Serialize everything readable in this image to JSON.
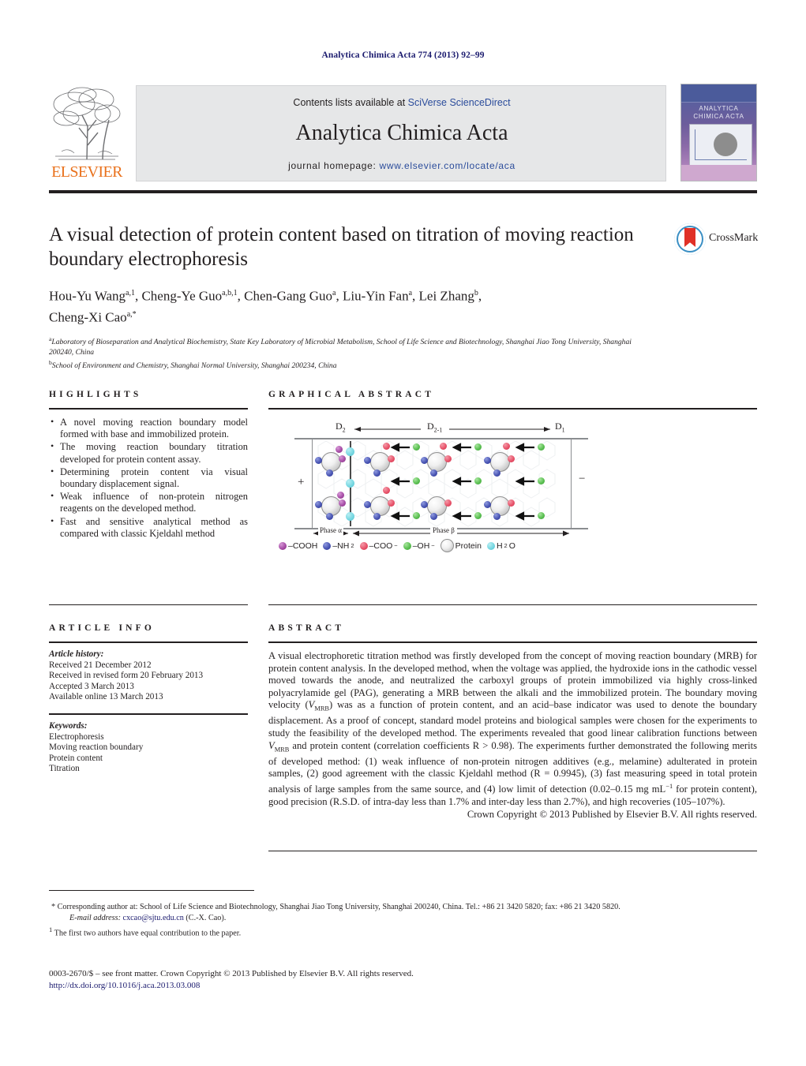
{
  "running_head": "Analytica Chimica Acta 774 (2013) 92–99",
  "masthead": {
    "publisher_name": "ELSEVIER",
    "contents_prefix": "Contents lists available at ",
    "contents_link": "SciVerse ScienceDirect",
    "journal_name": "Analytica Chimica Acta",
    "homepage_prefix": "journal homepage: ",
    "homepage_url": "www.elsevier.com/locate/aca",
    "cover_title_line1": "ANALYTICA",
    "cover_title_line2": "CHIMICA ACTA"
  },
  "article": {
    "title": "A visual detection of protein content based on titration of moving reaction boundary electrophoresis",
    "authors_line1_p1": "Hou-Yu Wang",
    "authors_line1_s1": "a,1",
    "authors_line1_p2": ", Cheng-Ye Guo",
    "authors_line1_s2": "a,b,1",
    "authors_line1_p3": ", Chen-Gang Guo",
    "authors_line1_s3": "a",
    "authors_line1_p4": ", Liu-Yin Fan",
    "authors_line1_s4": "a",
    "authors_line1_p5": ", Lei Zhang",
    "authors_line1_s5": "b",
    "authors_line1_p6": ",",
    "authors_line2_p1": "Cheng-Xi Cao",
    "authors_line2_s1": "a,*",
    "affiliation_a_marker": "a",
    "affiliation_a": "Laboratory of Bioseparation and Analytical Biochemistry, State Key Laboratory of Microbial Metabolism, School of Life Science and Biotechnology, Shanghai Jiao Tong University, Shanghai 200240, China",
    "affiliation_b_marker": "b",
    "affiliation_b": "School of Environment and Chemistry, Shanghai Normal University, Shanghai 200234, China",
    "crossmark_label": "CrossMark"
  },
  "highlights": {
    "heading": "HIGHLIGHTS",
    "items": [
      "A novel moving reaction boundary model formed with base and immobilized protein.",
      "The moving reaction boundary titration developed for protein content assay.",
      "Determining protein content via visual boundary displacement signal.",
      "Weak influence of non-protein nitrogen reagents on the developed method.",
      "Fast and sensitive analytical method as compared with classic Kjeldahl method"
    ]
  },
  "graphical_abstract": {
    "heading": "GRAPHICAL ABSTRACT",
    "label_d2": "D",
    "label_d2_sub": "2",
    "label_d21": "D",
    "label_d21_sub": "2-1",
    "label_d1": "D",
    "label_d1_sub": "1",
    "anode_sign": "+",
    "cathode_sign": "−",
    "phase_alpha": "Phase α",
    "phase_beta": "Phase β",
    "legend": [
      {
        "name": "cooh-legend",
        "label": "–COOH",
        "color": "#a84fa8"
      },
      {
        "name": "nh2-legend",
        "label": "–NH",
        "sub": "2",
        "color": "#4a56b4"
      },
      {
        "name": "coo-legend",
        "label": "–COO",
        "sup": "−",
        "color": "#e8556c"
      },
      {
        "name": "oh-legend",
        "label": "–OH",
        "sup": "−",
        "color": "#5cc153"
      },
      {
        "name": "protein-legend",
        "label": "Protein",
        "color": "#cccccc"
      },
      {
        "name": "water-legend",
        "label": "H",
        "sub": "2",
        "label_tail": "O",
        "color": "#79d8e2"
      }
    ]
  },
  "article_info": {
    "heading": "ARTICLE INFO",
    "history_label": "Article history:",
    "history": [
      "Received 21 December 2012",
      "Received in revised form 20 February 2013",
      "Accepted 3 March 2013",
      "Available online 13 March 2013"
    ],
    "keywords_label": "Keywords:",
    "keywords": [
      "Electrophoresis",
      "Moving reaction boundary",
      "Protein content",
      "Titration"
    ]
  },
  "abstract": {
    "heading": "ABSTRACT",
    "p1": "A visual electrophoretic titration method was firstly developed from the concept of moving reaction boundary (MRB) for protein content analysis. In the developed method, when the voltage was applied, the hydroxide ions in the cathodic vessel moved towards the anode, and neutralized the carboxyl groups of protein immobilized via highly cross-linked polyacrylamide gel (PAG), generating a MRB between the alkali and the immobilized protein. The boundary moving velocity (",
    "v_symbol": "V",
    "v_subscript": "MRB",
    "p2": ") was as a function of protein content, and an acid–base indicator was used to denote the boundary displacement. As a proof of concept, standard model proteins and biological samples were chosen for the experiments to study the feasibility of the developed method. The experiments revealed that good linear calibration functions between ",
    "p3": " and protein content (correlation coefficients R > 0.98). The experiments further demonstrated the following merits of developed method: (1) weak influence of non-protein nitrogen additives (e.g., melamine) adulterated in protein samples, (2) good agreement with the classic Kjeldahl method (R = 0.9945), (3) fast measuring speed in total protein analysis of large samples from the same source, and (4) low limit of detection (0.02–0.15 mg mL",
    "p3_sup": "−1",
    "p4": " for protein content), good precision (R.S.D. of intra-day less than 1.7% and inter-day less than 2.7%), and high recoveries (105–107%).",
    "copyright": "Crown Copyright © 2013 Published by Elsevier B.V. All rights reserved."
  },
  "footnotes": {
    "corresponding": "* Corresponding author at: School of Life Science and Biotechnology, Shanghai Jiao Tong University, Shanghai 200240, China. Tel.: +86 21 3420 5820; fax: +86 21 3420 5820.",
    "email_label": "E-mail address:",
    "email": "cxcao@sjtu.edu.cn",
    "email_suffix": "(C.-X. Cao).",
    "equal_contribution_marker": "1",
    "equal_contribution": "The first two authors have equal contribution to the paper."
  },
  "footer": {
    "issn_line": "0003-2670/$ – see front matter. Crown Copyright © 2013 Published by Elsevier B.V. All rights reserved.",
    "doi": "http://dx.doi.org/10.1016/j.aca.2013.03.008"
  }
}
